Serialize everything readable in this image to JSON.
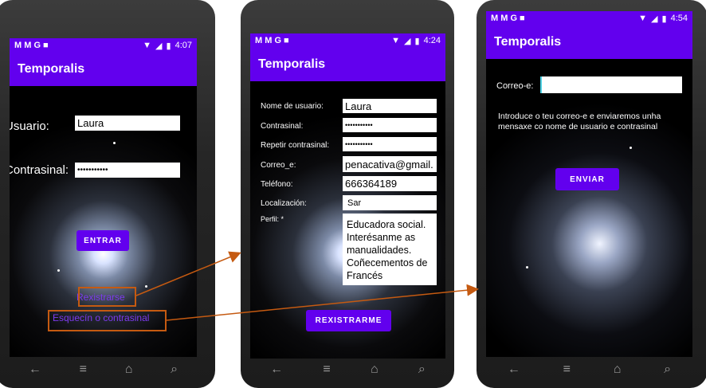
{
  "colors": {
    "accent": "#6200ee",
    "link": "#7c3aed",
    "annotation": "#c55a11"
  },
  "nav_icons": [
    "back-icon",
    "home-icon",
    "recents-icon",
    "search-icon"
  ],
  "screen1": {
    "status": {
      "icons": "M M G ■",
      "time": "4:07"
    },
    "app_title": "Temporalis",
    "usuario_label": "Usuario:",
    "usuario_value": "Laura",
    "contrasinal_label": "Contrasinal:",
    "contrasinal_value": "•••••••••••",
    "entrar_button": "ENTRAR",
    "rexistrarse_link": "Rexistrarse",
    "esquecin_link": "Esquecín o contrasinal"
  },
  "screen2": {
    "status": {
      "icons": "M M G ■",
      "time": "4:24"
    },
    "app_title": "Temporalis",
    "fields": [
      {
        "label": "Nome de usuario:",
        "value": "Laura"
      },
      {
        "label": "Contrasinal:",
        "value": "•••••••••••"
      },
      {
        "label": "Repetir contrasinal:",
        "value": "•••••••••••"
      },
      {
        "label": "Correo_e:",
        "value": "penacativa@gmail."
      },
      {
        "label": "Teléfono:",
        "value": "666364189"
      },
      {
        "label": "Localización:",
        "value": "Sar"
      }
    ],
    "perfil_label": "Perfil: *",
    "perfil_value": "Educadora social. Interésanme as manualidades. Coñecementos de Francés",
    "rexistrarme_button": "REXISTRARME"
  },
  "screen3": {
    "status": {
      "icons": "M M G ■",
      "time": "4:54"
    },
    "app_title": "Temporalis",
    "correo_label": "Correo-e:",
    "correo_value": "",
    "info_text": "Introduce o teu correo-e e enviaremos unha mensaxe co nome de usuario e contrasinal",
    "enviar_button": "ENVIAR"
  }
}
